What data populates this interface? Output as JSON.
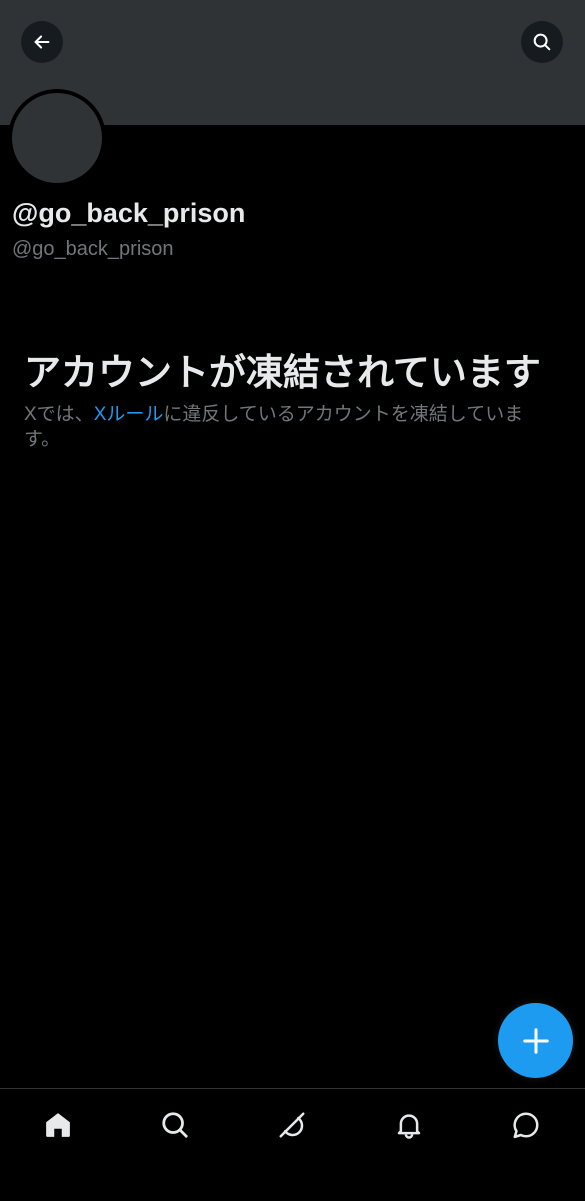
{
  "header": {
    "back_icon": "arrow-left-icon",
    "search_icon": "search-icon"
  },
  "profile": {
    "display_name": "@go_back_prison",
    "handle": "@go_back_prison"
  },
  "suspended": {
    "title": "アカウントが凍結されています",
    "desc_before": "Xでは、",
    "rules_link": "Xルール",
    "desc_after": "に違反しているアカウントを凍結しています。"
  },
  "fab": {
    "icon": "plus-icon"
  },
  "bottom_nav": {
    "items": [
      {
        "icon": "home-icon"
      },
      {
        "icon": "search-icon"
      },
      {
        "icon": "grok-icon"
      },
      {
        "icon": "bell-icon"
      },
      {
        "icon": "message-icon"
      }
    ]
  },
  "colors": {
    "background": "#000000",
    "banner": "#2f3336",
    "accent": "#1d9bf0",
    "primary_text": "#e7e9ea",
    "secondary_text": "#71767b"
  }
}
